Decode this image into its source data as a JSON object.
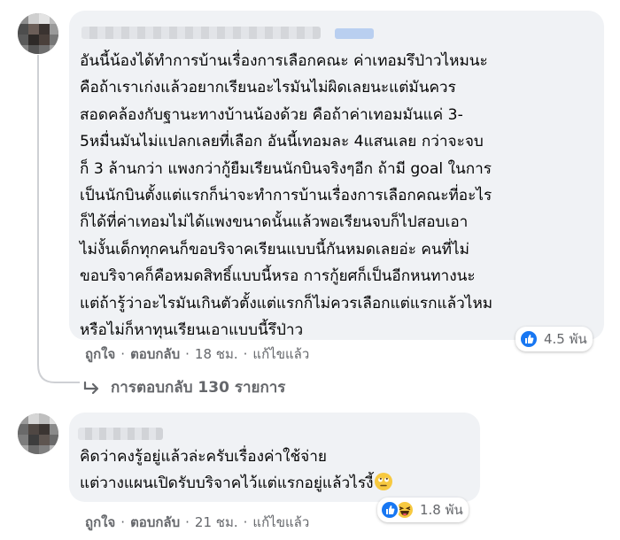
{
  "comments": [
    {
      "text_lines": [
        "อันนี้น้องได้ทำการบ้านเรื่องการเลือกคณะ ค่าเทอมรึป่าวไหมนะ",
        "คือถ้าเราเก่งแล้วอยากเรียนอะไรมันไม่ผิดเลยนะแต่มันควร",
        "สอดคล้องกับฐานะทางบ้านน้องด้วย คือถ้าค่าเทอมมันแค่ 3-",
        "5หมื่นมันไม่แปลกเลยที่เลือก อันนี้เทอมละ 4แสนเลย กว่าจะจบ",
        "ก็ 3 ล้านกว่า แพงกว่ากู้ยืมเรียนนักบินจริงๆอีก ถ้ามี goal ในการ",
        "เป็นนักบินตั้งแต่แรกก็น่าจะทำการบ้านเรื่องการเลือกคณะที่อะไร",
        "ก็ได้ที่ค่าเทอมไม่ได้แพงขนาดนั้นแล้วพอเรียนจบก็ไปสอบเอา",
        "ไม่งั้นเด็กทุกคนก็ขอบริจาคเรียนแบบนี้กันหมดเลยอ่ะ คนที่ไม่",
        "ขอบริจาคก็คือหมดสิทธิ์แบบนี้หรอ การกู้ยศก็เป็นอีกหนทางนะ",
        "แต่ถ้ารู้ว่าอะไรมันเกินตัวตั้งแต่แรกก็ไม่ควรเลือกแต่แรกแล้วไหม",
        "หรือไม่ก็หาทุนเรียนเอาแบบนี้รึป่าว"
      ],
      "reaction_count": "4.5 พัน",
      "reaction_icons": [
        "like-icon"
      ],
      "like_label": "ถูกใจ",
      "reply_label": "ตอบกลับ",
      "timestamp": "18 ชม.",
      "edited_label": "แก้ไขแล้ว",
      "separator": "·",
      "replies_link": "การตอบกลับ 130 รายการ"
    },
    {
      "text_lines": [
        "คิดว่าคงรู้อยู่แล้วล่ะครับเรื่องค่าใช้จ่าย",
        "แต่วางแผนเปิดรับบริจาคไว้แต่แรกอยู่แล้วไรงี้"
      ],
      "inline_emoji": "rolling-eyes-emoji-icon",
      "reaction_count": "1.8 พัน",
      "reaction_icons": [
        "like-icon",
        "haha-icon"
      ],
      "like_label": "ถูกใจ",
      "reply_label": "ตอบกลับ",
      "timestamp": "21 ชม.",
      "edited_label": "แก้ไขแล้ว",
      "separator": "·"
    }
  ],
  "colors": {
    "bubble": "#f0f2f5",
    "secondary_text": "#65676b",
    "like_blue": "#1877f2",
    "haha_yellow": "#f7c940",
    "thread_line": "#ced0d4"
  }
}
